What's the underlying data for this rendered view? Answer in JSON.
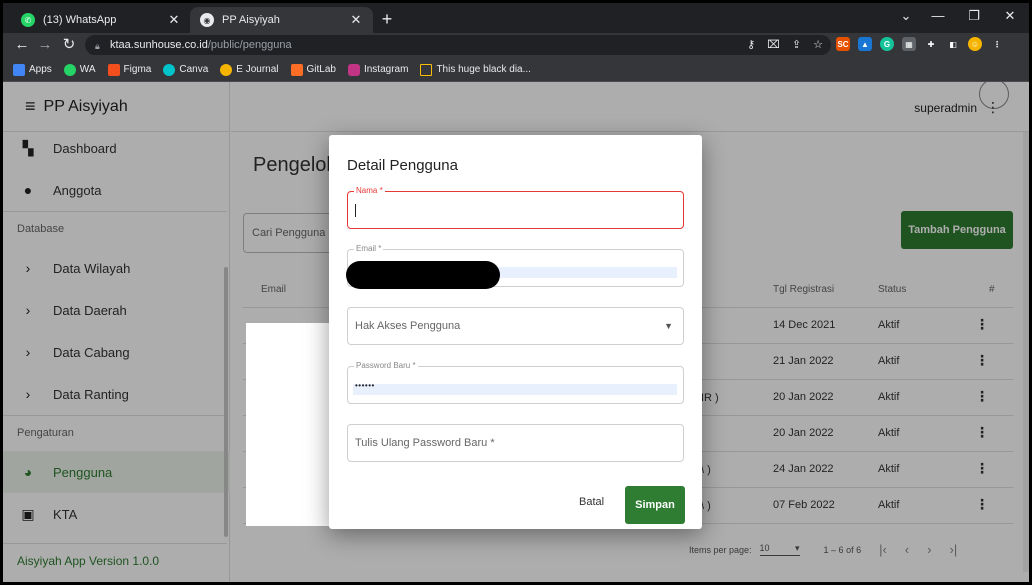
{
  "browser": {
    "tabs": [
      {
        "title": "(13) WhatsApp",
        "favicon": "whatsapp-icon",
        "active": false
      },
      {
        "title": "PP Aisyiyah",
        "favicon": "globe-icon",
        "active": true
      }
    ],
    "new_tab_symbol": "+",
    "url_host": "ktaa.sunhouse.co.id",
    "url_path": "/public/pengguna",
    "bookmarks": [
      {
        "label": "Apps",
        "color": "#4285f4"
      },
      {
        "label": "WA",
        "color": "#25d366"
      },
      {
        "label": "Figma",
        "color": "#f24e1e"
      },
      {
        "label": "Canva",
        "color": "#00c4cc"
      },
      {
        "label": "E Journal",
        "color": "#f4b400"
      },
      {
        "label": "GitLab",
        "color": "#fc6d26"
      },
      {
        "label": "Instagram",
        "color": "#c13584"
      },
      {
        "label": "This huge black dia...",
        "color": "#fbbc04"
      }
    ]
  },
  "sidebar": {
    "brand": "PP Aisyiyah",
    "items_top": [
      {
        "label": "Dashboard",
        "icon": "dashboard-icon"
      },
      {
        "label": "Anggota",
        "icon": "person-icon"
      }
    ],
    "section_database": "Database",
    "items_database": [
      {
        "label": "Data Wilayah"
      },
      {
        "label": "Data Daerah"
      },
      {
        "label": "Data Cabang"
      },
      {
        "label": "Data Ranting"
      }
    ],
    "section_pengaturan": "Pengaturan",
    "items_pengaturan": [
      {
        "label": "Pengguna",
        "icon": "account-circle-icon",
        "active": true
      },
      {
        "label": "KTA",
        "icon": "badge-icon"
      }
    ],
    "version": "Aisyiyah App Version 1.0.0"
  },
  "header": {
    "user": "superadmin"
  },
  "main": {
    "heading": "Pengelola",
    "search_placeholder": "Cari Pengguna ...",
    "add_button": "Tambah Pengguna",
    "columns": {
      "email": "Email",
      "tgl": "Tgl Registrasi",
      "status": "Status",
      "menu": "#"
    },
    "rows": [
      {
        "peek": "",
        "date": "14 Dec 2021",
        "status": "Aktif"
      },
      {
        "peek": "",
        "date": "21 Jan 2022",
        "status": "Aktif"
      },
      {
        "peek": "IR )",
        "date": "20 Jan 2022",
        "status": "Aktif"
      },
      {
        "peek": "",
        "date": "20 Jan 2022",
        "status": "Aktif"
      },
      {
        "peek": "\\ )",
        "date": "24 Jan 2022",
        "status": "Aktif"
      },
      {
        "peek": "\\ )",
        "date": "07 Feb 2022",
        "status": "Aktif"
      }
    ],
    "pager": {
      "label": "Items per page:",
      "value": "10",
      "range": "1 – 6 of 6"
    }
  },
  "dialog": {
    "title": "Detail Pengguna",
    "nama_label": "Nama *",
    "email_label": "Email *",
    "hak_akses_placeholder": "Hak Akses Pengguna",
    "password_label": "Password Baru *",
    "password_value": "••••••",
    "confirm_placeholder": "Tulis Ulang Password Baru *",
    "cancel": "Batal",
    "save": "Simpan"
  }
}
